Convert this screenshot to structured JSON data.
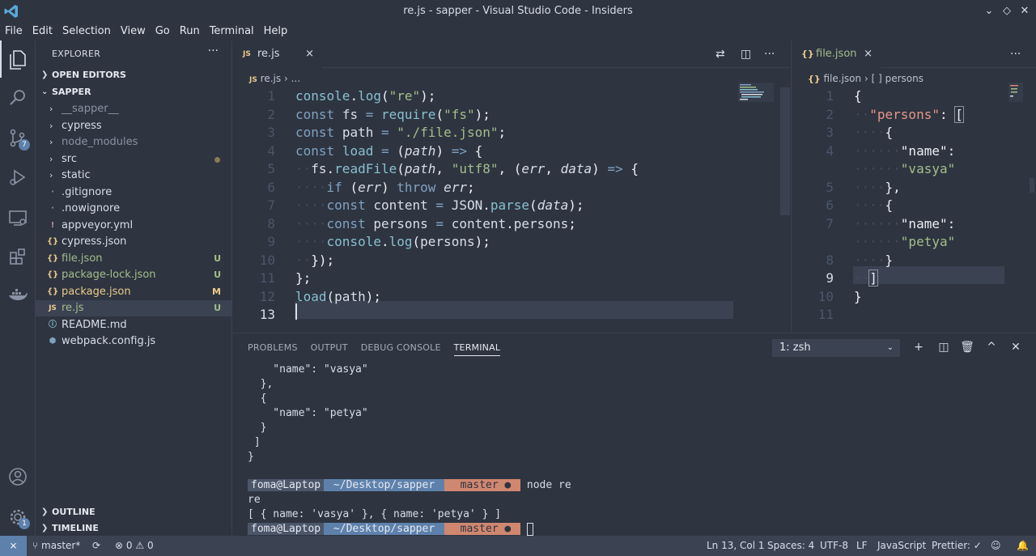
{
  "window": {
    "title": "re.js - sapper - Visual Studio Code - Insiders"
  },
  "menu": [
    "File",
    "Edit",
    "Selection",
    "View",
    "Go",
    "Run",
    "Terminal",
    "Help"
  ],
  "activity": {
    "scm_badge": "7",
    "settings_badge": "1"
  },
  "sidebar": {
    "title": "EXPLORER",
    "more": "···",
    "open_editors": "OPEN EDITORS",
    "workspace": "SAPPER",
    "items": [
      {
        "name": "__sapper__",
        "type": "folder",
        "dim": true
      },
      {
        "name": "cypress",
        "type": "folder"
      },
      {
        "name": "node_modules",
        "type": "folder",
        "dim": true
      },
      {
        "name": "src",
        "type": "folder",
        "dot": true
      },
      {
        "name": "static",
        "type": "folder"
      },
      {
        "name": ".gitignore",
        "type": "file",
        "icon": "·"
      },
      {
        "name": ".nowignore",
        "type": "file",
        "icon": "·"
      },
      {
        "name": "appveyor.yml",
        "type": "file",
        "icon": "!"
      },
      {
        "name": "cypress.json",
        "type": "file",
        "icon": "{}"
      },
      {
        "name": "file.json",
        "type": "file",
        "icon": "{}",
        "status": "U"
      },
      {
        "name": "package-lock.json",
        "type": "file",
        "icon": "{}",
        "status": "U"
      },
      {
        "name": "package.json",
        "type": "file",
        "icon": "{}",
        "status": "M"
      },
      {
        "name": "re.js",
        "type": "file",
        "icon": "JS",
        "status": "U",
        "selected": true
      },
      {
        "name": "README.md",
        "type": "file",
        "icon": "ⓘ"
      },
      {
        "name": "webpack.config.js",
        "type": "file",
        "icon": "⬢"
      }
    ],
    "outline": "OUTLINE",
    "timeline": "TIMELINE"
  },
  "editor1": {
    "tab": {
      "icon": "JS",
      "label": "re.js",
      "close": "×"
    },
    "breadcrumb": [
      "re.js",
      "..."
    ],
    "lines": [
      "1",
      "2",
      "3",
      "4",
      "5",
      "6",
      "7",
      "8",
      "9",
      "10",
      "11",
      "12",
      "13"
    ]
  },
  "editor2": {
    "tab": {
      "icon": "{}",
      "label": "file.json",
      "close": "×"
    },
    "more": "···",
    "breadcrumb": [
      "file.json",
      "[ ] persons"
    ],
    "lines": [
      "1",
      "2",
      "3",
      "4",
      "",
      "5",
      "6",
      "7",
      "",
      "8",
      "9",
      "10",
      "11"
    ]
  },
  "panel": {
    "tabs": [
      "PROBLEMS",
      "OUTPUT",
      "DEBUG CONSOLE",
      "TERMINAL"
    ],
    "active_tab": "TERMINAL",
    "terminal_select": "1: zsh",
    "terminal": {
      "l1": "    \"name\": \"vasya\"",
      "l2": "  },",
      "l3": "  {",
      "l4": "    \"name\": \"petya\"",
      "l5": "  }",
      "l6": " ]",
      "l7": "}",
      "prompt_user": "foma@Laptop",
      "prompt_dir": " ~/Desktop/sapper ",
      "prompt_git": "  master ● ",
      "cmd": " node re",
      "out1": "re",
      "out2": "[ { name: 'vasya' }, { name: 'petya' } ]"
    }
  },
  "status": {
    "branch": "master*",
    "errors": "0",
    "warnings": "0",
    "position": "Ln 13, Col 1",
    "spaces": "Spaces: 4",
    "encoding": "UTF-8",
    "eol": "LF",
    "language": "JavaScript",
    "prettier": "Prettier: ✓"
  },
  "colors": {
    "accent": "#5e81ac",
    "background": "#2e3440",
    "statusbar": "#3b4252"
  }
}
